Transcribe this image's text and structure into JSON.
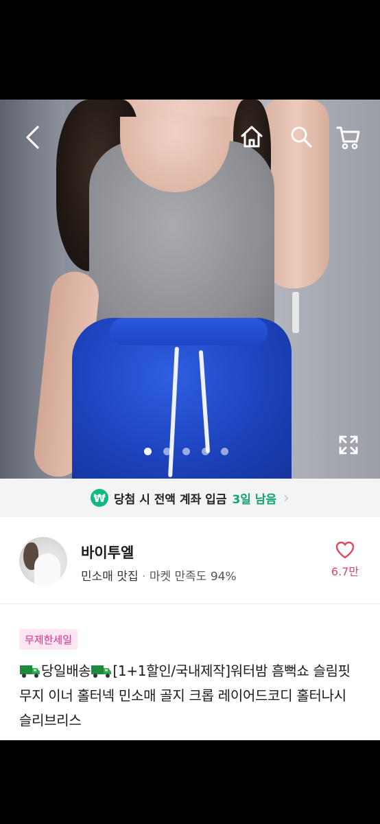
{
  "hero": {
    "image_alt": "product-photo",
    "page_indicator": {
      "total": 5,
      "active_index": 0
    }
  },
  "nav": {
    "back_icon": "chevron-left-icon",
    "home_icon": "home-icon",
    "search_icon": "search-icon",
    "cart_icon": "cart-icon",
    "expand_icon": "expand-icon"
  },
  "promo": {
    "badge": "₩",
    "text": "당첨 시 전액 계좌 입금",
    "days": "3일 남음",
    "chevron": "›"
  },
  "seller": {
    "name": "바이투엘",
    "category": "민소매 맛집",
    "separator": "·",
    "satisfaction": "마켓 만족도 94%",
    "likes": "6.7만"
  },
  "product": {
    "sale_badge": "무제한세일",
    "title_part1": "당일배송",
    "title_part2": "[1+1할인/국내제작]워터밤 흠뻑쇼 슬림핏 무지 이너 홀터넥 민소매 골지 크롭 레이어드코디 홀터나시 슬리브리스"
  },
  "colors": {
    "accent_green": "#10b981",
    "like_red": "#e0475a",
    "sale_pink": "#d3318a"
  }
}
